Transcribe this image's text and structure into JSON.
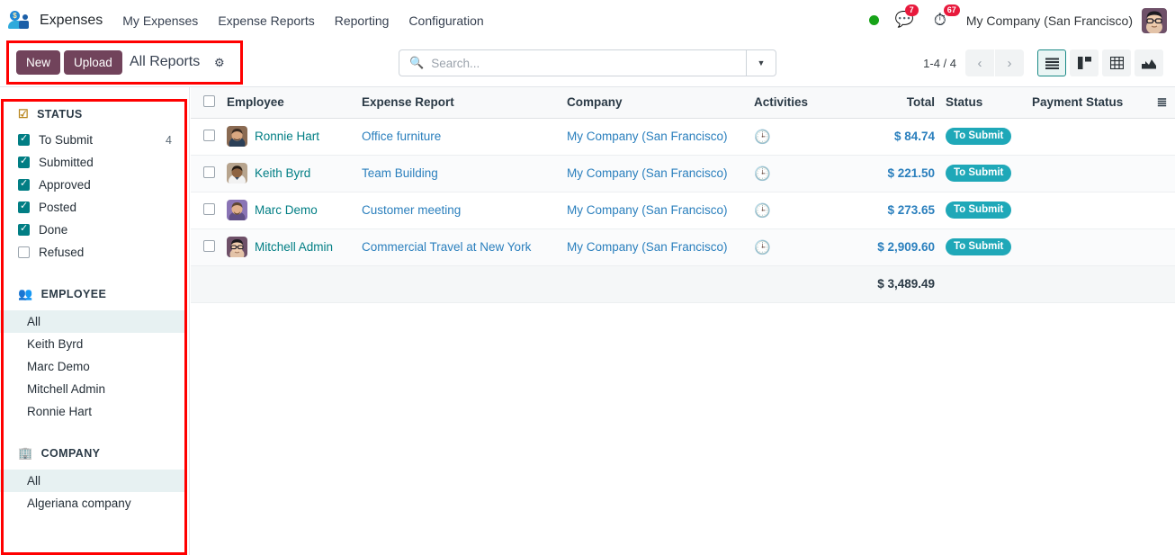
{
  "navbar": {
    "brand_icon": "expenses-app-icon",
    "brand": "Expenses",
    "menu": [
      {
        "label": "My Expenses"
      },
      {
        "label": "Expense Reports"
      },
      {
        "label": "Reporting"
      },
      {
        "label": "Configuration"
      }
    ],
    "status_dot_color": "#17a318",
    "messages_icon": "chat-icon",
    "messages_count": "7",
    "activities_icon": "clock-icon",
    "activities_count": "67",
    "company": "My Company (San Francisco)",
    "avatar_icon": "user-avatar"
  },
  "controlpanel": {
    "new_label": "New",
    "upload_label": "Upload",
    "title": "All Reports",
    "gear_icon": "gear-icon",
    "search_placeholder": "Search...",
    "search_value": "",
    "search_icon": "search-icon",
    "dropdown_icon": "chevron-down-icon",
    "pager": "1-4 / 4",
    "prev_icon": "chevron-left-icon",
    "next_icon": "chevron-right-icon",
    "views": [
      {
        "name": "list-view",
        "icon": "list-icon",
        "active": true
      },
      {
        "name": "kanban-view",
        "icon": "kanban-icon",
        "active": false
      },
      {
        "name": "pivot-view",
        "icon": "pivot-icon",
        "active": false
      },
      {
        "name": "graph-view",
        "icon": "graph-icon",
        "active": false
      }
    ]
  },
  "sidebar": {
    "status": {
      "icon": "checkbox-icon",
      "title": "STATUS",
      "options": [
        {
          "label": "To Submit",
          "checked": true,
          "count": "4"
        },
        {
          "label": "Submitted",
          "checked": true,
          "count": ""
        },
        {
          "label": "Approved",
          "checked": true,
          "count": ""
        },
        {
          "label": "Posted",
          "checked": true,
          "count": ""
        },
        {
          "label": "Done",
          "checked": true,
          "count": ""
        },
        {
          "label": "Refused",
          "checked": false,
          "count": ""
        }
      ]
    },
    "employee": {
      "icon": "people-icon",
      "title": "EMPLOYEE",
      "items": [
        {
          "label": "All",
          "selected": true
        },
        {
          "label": "Keith Byrd",
          "selected": false
        },
        {
          "label": "Marc Demo",
          "selected": false
        },
        {
          "label": "Mitchell Admin",
          "selected": false
        },
        {
          "label": "Ronnie Hart",
          "selected": false
        }
      ]
    },
    "company": {
      "icon": "building-icon",
      "title": "COMPANY",
      "items": [
        {
          "label": "All",
          "selected": true
        },
        {
          "label": "Algeriana company",
          "selected": false
        }
      ]
    }
  },
  "table": {
    "select_all_icon": "checkbox-icon",
    "columns": [
      "Employee",
      "Expense Report",
      "Company",
      "Activities",
      "Total",
      "Status",
      "Payment Status"
    ],
    "options_icon": "column-options-icon",
    "rows": [
      {
        "employee": "Ronnie Hart",
        "avatar": "avatar-ronnie-hart",
        "report": "Office furniture",
        "company": "My Company (San Francisco)",
        "activity_icon": "clock-icon",
        "total": "$ 84.74",
        "status": "To Submit",
        "payment_status": ""
      },
      {
        "employee": "Keith Byrd",
        "avatar": "avatar-keith-byrd",
        "report": "Team Building",
        "company": "My Company (San Francisco)",
        "activity_icon": "clock-icon",
        "total": "$ 221.50",
        "status": "To Submit",
        "payment_status": ""
      },
      {
        "employee": "Marc Demo",
        "avatar": "avatar-marc-demo",
        "report": "Customer meeting",
        "company": "My Company (San Francisco)",
        "activity_icon": "clock-icon",
        "total": "$ 273.65",
        "status": "To Submit",
        "payment_status": ""
      },
      {
        "employee": "Mitchell Admin",
        "avatar": "avatar-mitchell-admin",
        "report": "Commercial Travel at New York",
        "company": "My Company (San Francisco)",
        "activity_icon": "clock-icon",
        "total": "$ 2,909.60",
        "status": "To Submit",
        "payment_status": ""
      }
    ],
    "grand_total": "$ 3,489.49"
  },
  "colors": {
    "accent_purple": "#71435b",
    "accent_teal": "#017e84",
    "badge_teal": "#1fa8b8",
    "link_blue": "#2a7fbd",
    "annotation_red": "#ff0000",
    "notify_red": "#e8193c",
    "online_green": "#17a318"
  }
}
